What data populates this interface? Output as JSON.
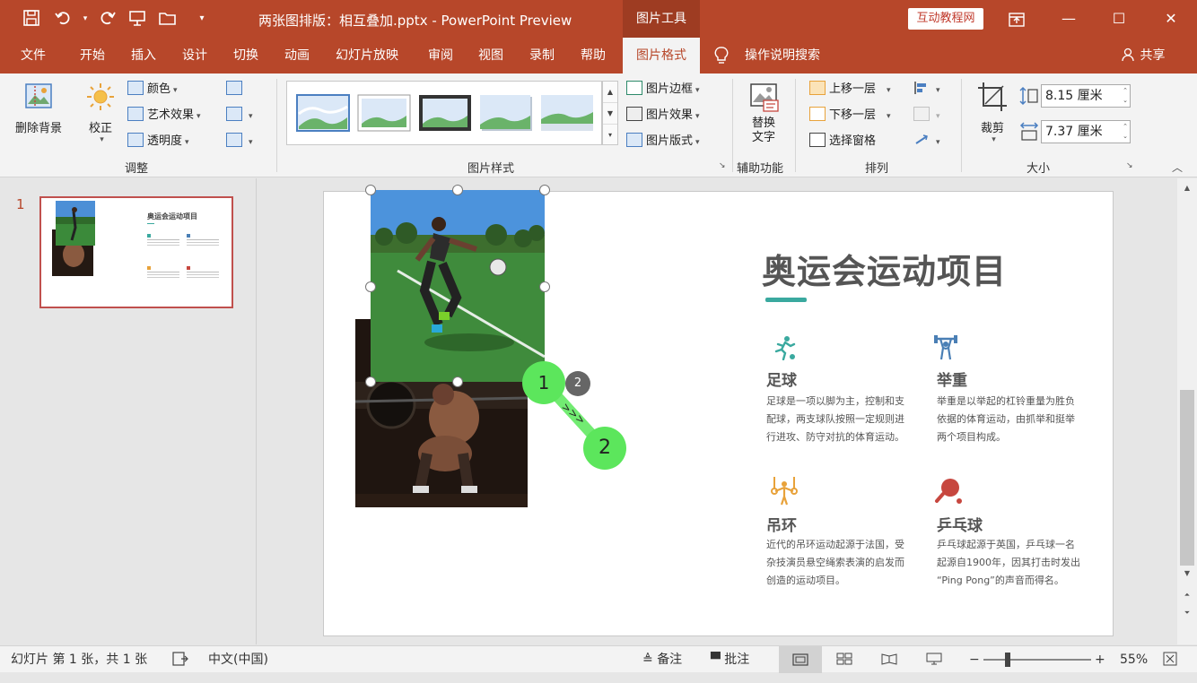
{
  "titlebar": {
    "title": "两张图排版：相互叠加.pptx - PowerPoint Preview",
    "tools_tab": "图片工具",
    "login": "互动教程网",
    "save_icon": "save-icon",
    "undo_icon": "undo-icon",
    "redo_icon": "redo-icon"
  },
  "tabs": [
    "文件",
    "开始",
    "插入",
    "设计",
    "切换",
    "动画",
    "幻灯片放映",
    "审阅",
    "视图",
    "录制",
    "帮助",
    "图片格式"
  ],
  "active_tab": "图片格式",
  "search_label": "操作说明搜索",
  "share_label": "共享",
  "ribbon": {
    "remove_bg": "删除背景",
    "corrections": "校正",
    "color": "颜色",
    "artistic": "艺术效果",
    "transparency": "透明度",
    "group_adjust": "调整",
    "group_styles": "图片样式",
    "border": "图片边框",
    "effects": "图片效果",
    "layout": "图片版式",
    "alt_text_line1": "替换",
    "alt_text_line2": "文字",
    "group_access": "辅助功能",
    "bring_forward": "上移一层",
    "send_backward": "下移一层",
    "selection_pane": "选择窗格",
    "group_arrange": "排列",
    "crop": "裁剪",
    "height": "8.15 厘米",
    "width": "7.37 厘米",
    "group_size": "大小"
  },
  "slide_number": "1",
  "slide": {
    "title": "奥运会运动项目",
    "accent_color": "#3aa99f",
    "items": [
      {
        "name": "足球",
        "desc_lines": [
          "足球是一项以脚为主，控制和支",
          "配球，两支球队按照一定规则进",
          "行进攻、防守对抗的体育运动。"
        ],
        "icon_color": "#3aa99f"
      },
      {
        "name": "举重",
        "desc_lines": [
          "举重是以举起的杠铃重量为胜负",
          "依据的体育运动，由抓举和挺举",
          "两个项目构成。"
        ],
        "icon_color": "#4a7fb5"
      },
      {
        "name": "吊环",
        "desc_lines": [
          "近代的吊环运动起源于法国，受",
          "杂技演员悬空绳索表演的启发而",
          "创造的运动项目。"
        ],
        "icon_color": "#e8a23a"
      },
      {
        "name": "乒乓球",
        "desc_lines": [
          "乒乓球起源于英国，乒乓球一名",
          "起源自1900年，因其打击时发出",
          "“Ping Pong”的声音而得名。"
        ],
        "icon_color": "#c7473f"
      }
    ]
  },
  "markers": {
    "m1": "1",
    "m2": "2",
    "m_small": "2"
  },
  "status": {
    "slide_info": "幻灯片 第 1 张，共 1 张",
    "language": "中文(中国)",
    "notes": "备注",
    "comments": "批注",
    "zoom": "55%"
  }
}
